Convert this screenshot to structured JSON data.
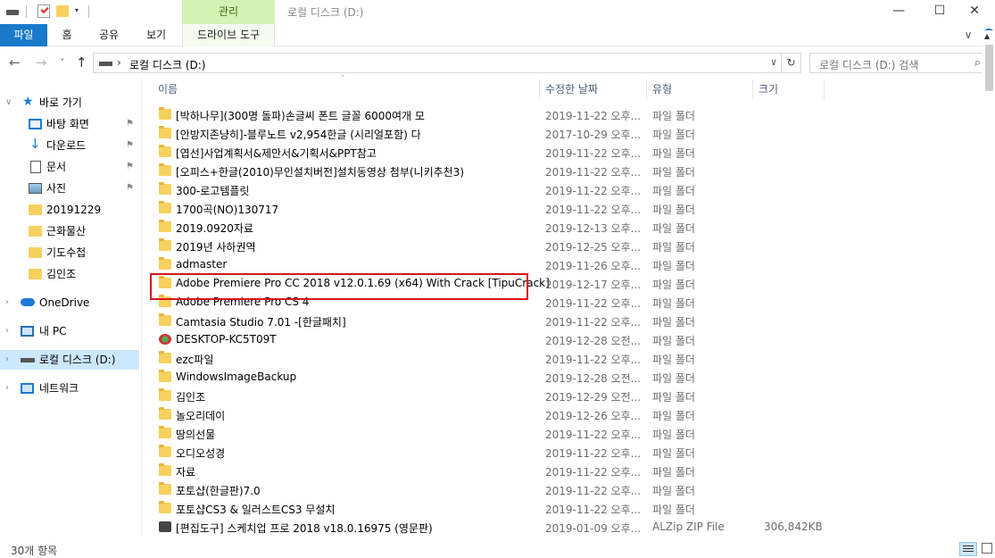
{
  "titlebar": {
    "quick_access_dropdown": "▾",
    "context_tab_group": "관리",
    "window_title": "로컬 디스크 (D:)",
    "minimize": "—",
    "maximize": "☐",
    "close": "✕"
  },
  "ribbon": {
    "tabs": [
      "파일",
      "홈",
      "공유",
      "보기"
    ],
    "context_tab": "드라이브 도구",
    "expand_icon": "∨",
    "help_icon": "?"
  },
  "address": {
    "back": "←",
    "forward": "→",
    "recent": "˅",
    "up": "↑",
    "chevron": "›",
    "path": "로컬 디스크 (D:)",
    "dropdown": "∨",
    "refresh": "↻",
    "search_placeholder": "로컬 디스크 (D:) 검색",
    "search_icon": "⌕"
  },
  "nav": {
    "quick_access": "바로 가기",
    "items": [
      {
        "label": "바탕 화면",
        "icon": "desktop-icon",
        "pinned": true
      },
      {
        "label": "다운로드",
        "icon": "download-icon",
        "pinned": true
      },
      {
        "label": "문서",
        "icon": "document-icon",
        "pinned": true
      },
      {
        "label": "사진",
        "icon": "picture-icon",
        "pinned": true
      },
      {
        "label": "20191229",
        "icon": "folder-icon",
        "pinned": false
      },
      {
        "label": "근화물산",
        "icon": "folder-icon",
        "pinned": false
      },
      {
        "label": "기도수첩",
        "icon": "folder-icon",
        "pinned": false
      },
      {
        "label": "김인조",
        "icon": "folder-icon",
        "pinned": false
      }
    ],
    "onedrive": "OneDrive",
    "this_pc": "내 PC",
    "local_disk": "로컬 디스크 (D:)",
    "network": "네트워크",
    "pin_glyph": "⚑",
    "expand_glyph": "›",
    "collapse_glyph": "∨",
    "star_glyph": "★",
    "down_glyph": "↓"
  },
  "columns": {
    "name": "이름",
    "date": "수정한 날짜",
    "type": "유형",
    "size": "크기",
    "sort_indicator": "˄"
  },
  "files": [
    {
      "name": "[박하나무](300명 돌파)손글씨 폰트 글꼴 6000여개 모",
      "date": "2019-11-22 오후...",
      "type": "파일 폴더",
      "size": ""
    },
    {
      "name": "[안방지존냥히]-블루노트 v2,954한글 (시리얼포함) 다",
      "date": "2017-10-29 오후...",
      "type": "파일 폴더",
      "size": ""
    },
    {
      "name": "[엽선]사업계획서&제안서&기획서&PPT참고",
      "date": "2019-11-22 오후...",
      "type": "파일 폴더",
      "size": ""
    },
    {
      "name": "[오피스+한글(2010)무인설치버전]설치동영상 첨부(니키추천3)",
      "date": "2019-11-22 오후...",
      "type": "파일 폴더",
      "size": ""
    },
    {
      "name": "300-로고템플릿",
      "date": "2019-11-22 오후...",
      "type": "파일 폴더",
      "size": ""
    },
    {
      "name": "1700곡(NO)130717",
      "date": "2019-11-22 오후...",
      "type": "파일 폴더",
      "size": ""
    },
    {
      "name": "2019.0920자료",
      "date": "2019-12-13 오후...",
      "type": "파일 폴더",
      "size": ""
    },
    {
      "name": "2019년 사하권역",
      "date": "2019-12-25 오후...",
      "type": "파일 폴더",
      "size": ""
    },
    {
      "name": "admaster",
      "date": "2019-11-26 오후...",
      "type": "파일 폴더",
      "size": ""
    },
    {
      "name": "Adobe Premiere Pro CC 2018 v12.0.1.69 (x64) With Crack [TipuCrack]",
      "date": "2019-12-17 오후...",
      "type": "파일 폴더",
      "size": ""
    },
    {
      "name": "Adobe Premiere Pro CS 4",
      "date": "2019-11-22 오후...",
      "type": "파일 폴더",
      "size": ""
    },
    {
      "name": "Camtasia Studio 7.01 -[한글패치]",
      "date": "2019-11-22 오후...",
      "type": "파일 폴더",
      "size": ""
    },
    {
      "name": "DESKTOP-KC5T09T",
      "date": "2019-12-28 오전...",
      "type": "파일 폴더",
      "size": ""
    },
    {
      "name": "ezc파일",
      "date": "2019-11-22 오후...",
      "type": "파일 폴더",
      "size": ""
    },
    {
      "name": "WindowsImageBackup",
      "date": "2019-12-28 오전...",
      "type": "파일 폴더",
      "size": ""
    },
    {
      "name": "김인조",
      "date": "2019-12-29 오전...",
      "type": "파일 폴더",
      "size": ""
    },
    {
      "name": "놀오리데이",
      "date": "2019-12-26 오후...",
      "type": "파일 폴더",
      "size": ""
    },
    {
      "name": "땅의선물",
      "date": "2019-11-22 오후...",
      "type": "파일 폴더",
      "size": ""
    },
    {
      "name": "오디오성경",
      "date": "2019-11-22 오후...",
      "type": "파일 폴더",
      "size": ""
    },
    {
      "name": "자료",
      "date": "2019-11-22 오후...",
      "type": "파일 폴더",
      "size": ""
    },
    {
      "name": "포토샵(한글판)7.0",
      "date": "2019-11-22 오후...",
      "type": "파일 폴더",
      "size": ""
    },
    {
      "name": "포토샵CS3 & 일러스트CS3 무설치",
      "date": "2019-11-22 오후...",
      "type": "파일 폴더",
      "size": ""
    },
    {
      "name": "[편집도구] 스케치업 프로 2018 v18.0.16975 (영문판)",
      "date": "2019-01-09 오후...",
      "type": "ALZip ZIP File",
      "size": "306,842KB"
    }
  ],
  "status": {
    "item_count": "30개 항목"
  },
  "scrollbar": {
    "up_arrow": "▲"
  },
  "colors": {
    "file_tab": "#1979ca",
    "context_tab": "#d4f2b4",
    "folder": "#f7d15e",
    "selection": "#cce8ff",
    "highlight_box": "#d7141a"
  }
}
